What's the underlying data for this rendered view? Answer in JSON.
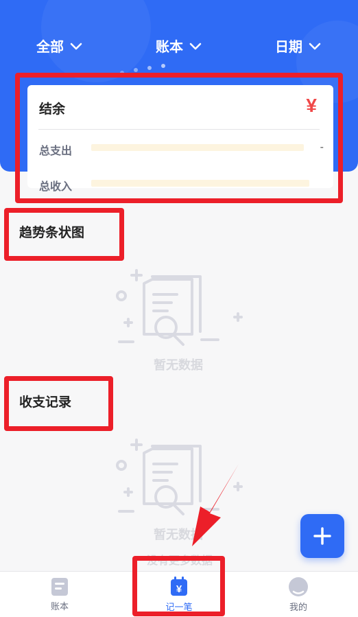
{
  "filters": [
    {
      "label": "全部"
    },
    {
      "label": "账本"
    },
    {
      "label": "日期"
    }
  ],
  "summary": {
    "title": "结余",
    "currency_symbol": "¥",
    "expense_label": "总支出",
    "expense_value": "-",
    "income_label": "总收入"
  },
  "trend": {
    "title": "趋势条状图",
    "empty_text": "暂无数据"
  },
  "records": {
    "title": "收支记录",
    "empty_text": "暂无数据",
    "peek_text": "没有更多数据"
  },
  "fab": {
    "icon": "plus-icon"
  },
  "nav": [
    {
      "label": "账本",
      "icon": "ledger-icon"
    },
    {
      "label": "记一笔",
      "icon": "record-icon",
      "active": true
    },
    {
      "label": "我的",
      "icon": "profile-icon"
    }
  ],
  "colors": {
    "primary": "#2f6bf5",
    "currency": "#f04747",
    "annotation": "#ec1f29"
  }
}
